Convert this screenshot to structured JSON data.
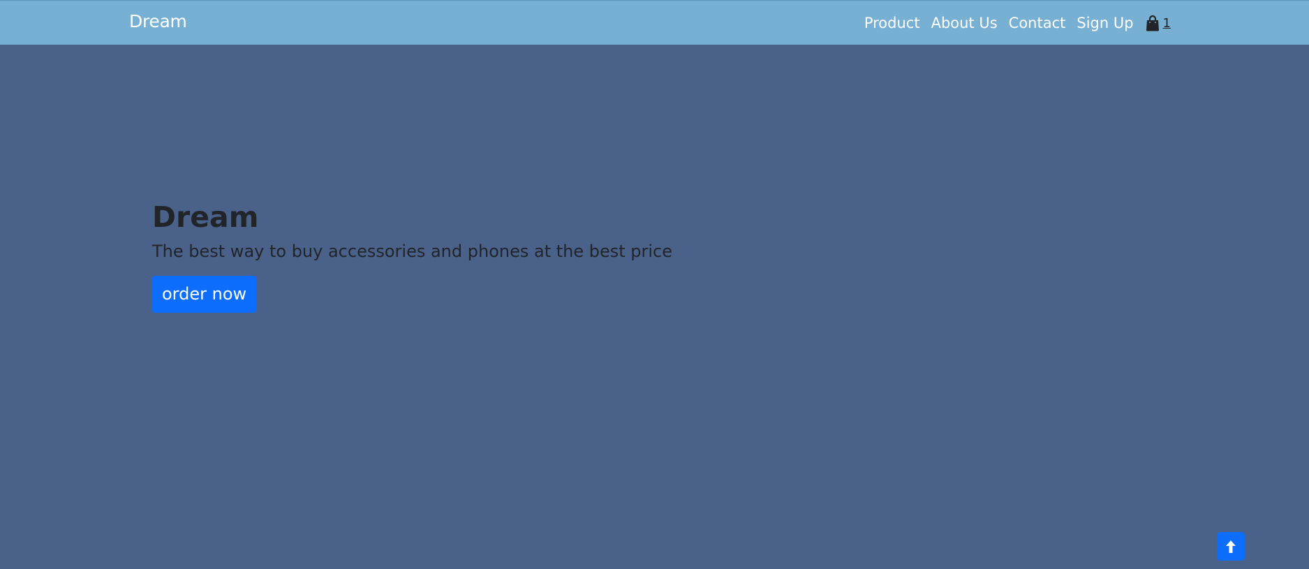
{
  "navbar": {
    "brand": "Dream",
    "links": [
      {
        "label": "Product"
      },
      {
        "label": "About Us"
      },
      {
        "label": "Contact"
      },
      {
        "label": "Sign Up"
      }
    ],
    "cart": {
      "icon": "shopping-bag-icon",
      "count": "1"
    }
  },
  "hero": {
    "title": "Dream",
    "subtitle": "The best way to buy accessories and phones at the best price",
    "cta_label": "order now"
  },
  "scroll_top": {
    "icon": "arrow-up-icon"
  },
  "colors": {
    "navbar_bg": "#78b0d3",
    "page_bg": "#4a6189",
    "primary": "#0d6efd",
    "text_dark": "#212529"
  }
}
